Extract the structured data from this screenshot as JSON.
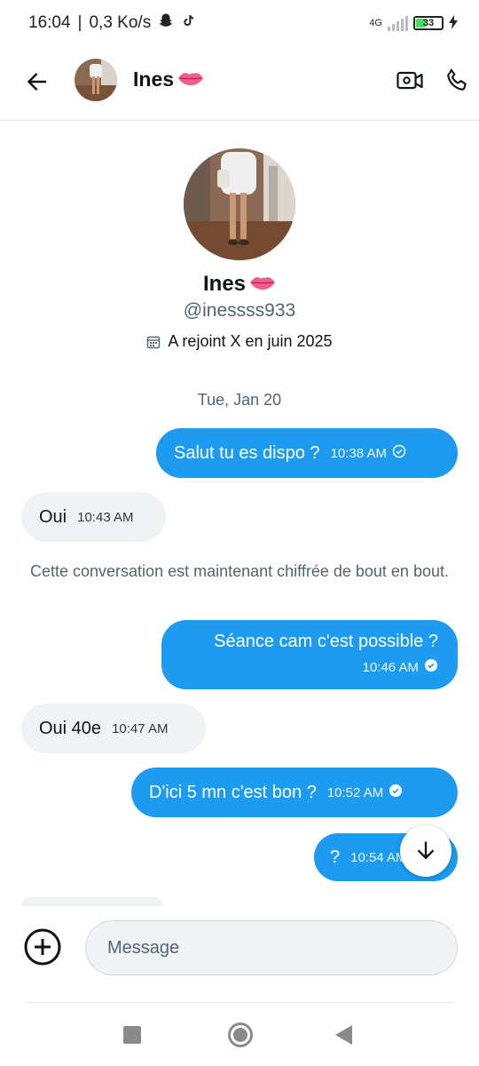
{
  "status_bar": {
    "time": "16:04",
    "separator": "|",
    "speed": "0,3 Ko/s",
    "network": "4G",
    "battery": "33",
    "icons": [
      "snapchat-icon",
      "tiktok-icon",
      "signal-icon",
      "battery-icon",
      "charging-icon"
    ]
  },
  "header": {
    "name": "Ines",
    "name_emoji": "lips-emoji",
    "icons": [
      "back-arrow-icon",
      "video-call-icon",
      "phone-icon"
    ]
  },
  "profile": {
    "name": "Ines",
    "handle": "@inessss933",
    "joined": "A rejoint X en juin 2025",
    "joined_icon": "calendar-icon"
  },
  "conversation": {
    "date_separator": "Tue, Jan 20",
    "system_message": "Cette conversation est maintenant chiffrée de bout en bout.",
    "messages": [
      {
        "direction": "outgoing",
        "text": "Salut tu es dispo ?",
        "time": "10:38 AM",
        "status": "sent"
      },
      {
        "direction": "incoming",
        "text": "Oui",
        "time": "10:43 AM"
      },
      {
        "direction": "outgoing",
        "text": "Séance cam c'est possible ?",
        "time": "10:46 AM",
        "status": "read"
      },
      {
        "direction": "incoming",
        "text": "Oui 40e",
        "time": "10:47 AM"
      },
      {
        "direction": "outgoing",
        "text": "D'ici 5 mn c'est bon ?",
        "time": "10:52 AM",
        "status": "read"
      },
      {
        "direction": "outgoing",
        "text": "?",
        "time": "10:54 AM",
        "status": "read"
      }
    ]
  },
  "composer": {
    "placeholder": "Message",
    "add_icon": "plus-circle-icon"
  },
  "scroll_button_icon": "arrow-down-icon",
  "nav_bar": {
    "icons": [
      "recents-square-icon",
      "home-circle-icon",
      "back-triangle-icon"
    ]
  },
  "colors": {
    "accent": "#1d9bf0",
    "incoming_bubble": "#eff3f4",
    "secondary_text": "#536471"
  }
}
